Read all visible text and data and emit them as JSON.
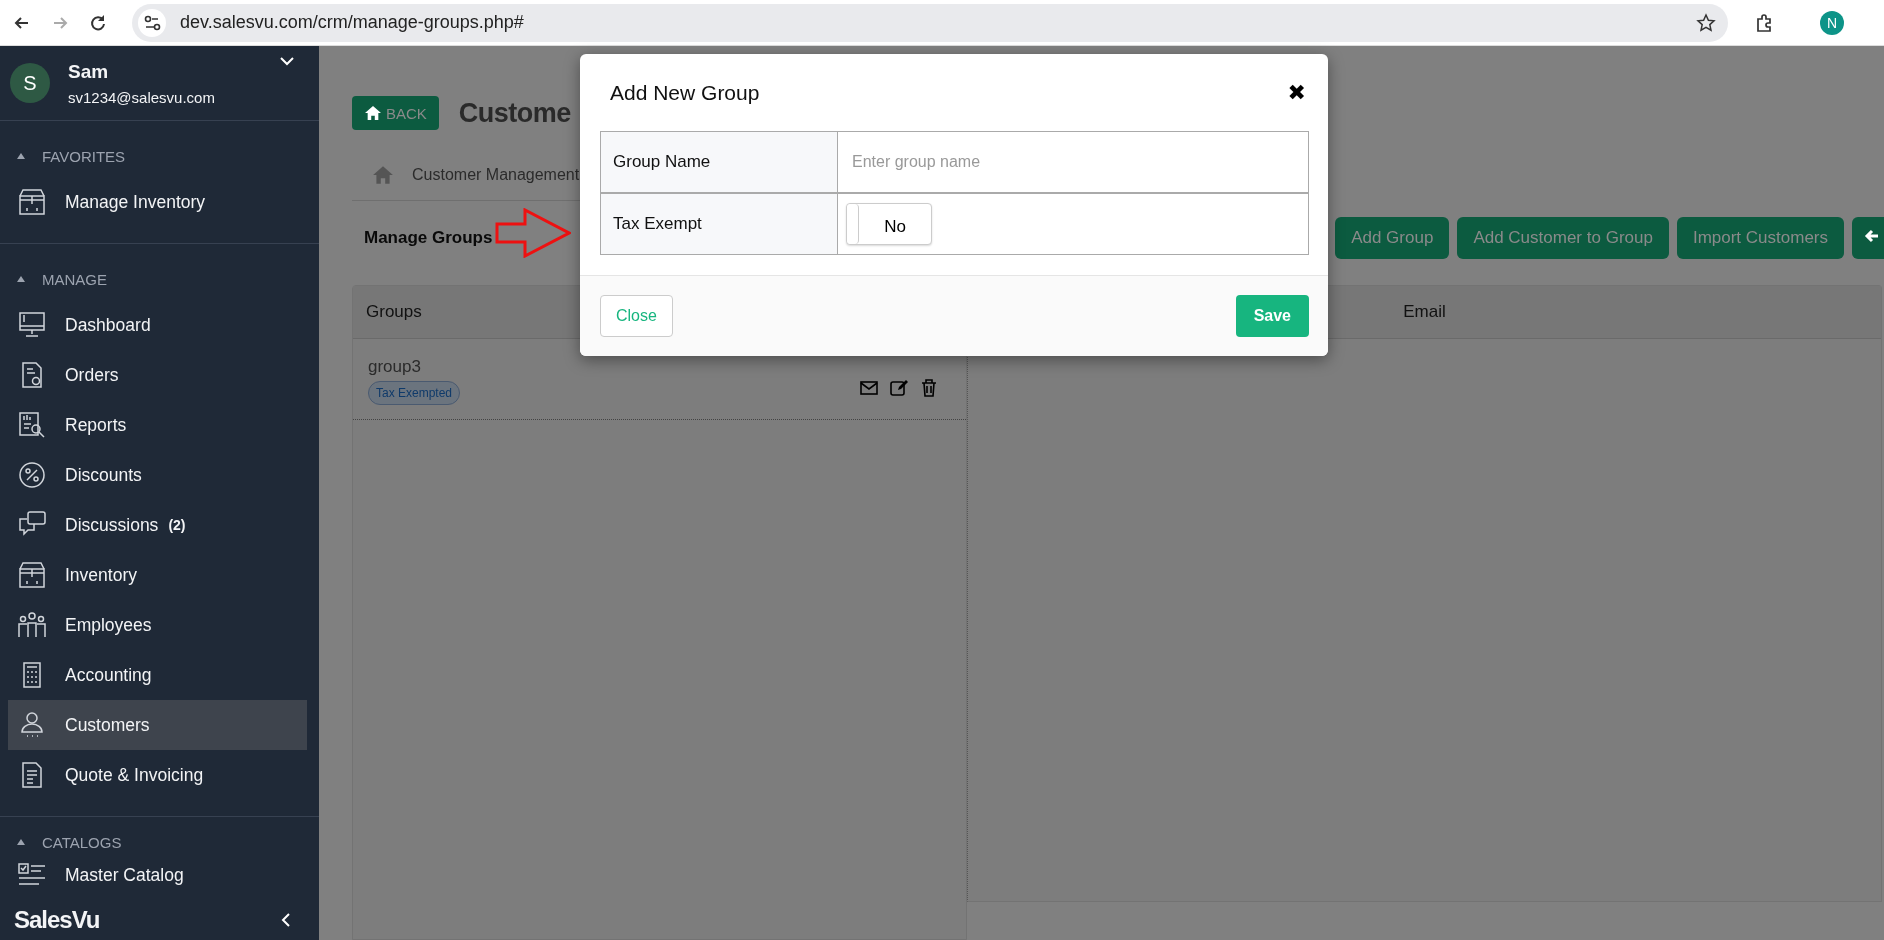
{
  "browser": {
    "url": "dev.salesvu.com/crm/manage-groups.php#",
    "profile": "N"
  },
  "sidebar": {
    "user": {
      "initial": "S",
      "name": "Sam",
      "email": "sv1234@salesvu.com"
    },
    "sections": [
      {
        "title": "FAVORITES",
        "expanded": true,
        "items": [
          {
            "label": "Manage Inventory",
            "selected": false
          }
        ]
      },
      {
        "title": "MANAGE",
        "expanded": true,
        "items": [
          {
            "label": "Dashboard",
            "selected": false
          },
          {
            "label": "Orders",
            "selected": false
          },
          {
            "label": "Reports",
            "selected": false
          },
          {
            "label": "Discounts",
            "selected": false
          },
          {
            "label": "Discussions",
            "count": "(2)",
            "selected": false
          },
          {
            "label": "Inventory",
            "selected": false
          },
          {
            "label": "Employees",
            "selected": false
          },
          {
            "label": "Accounting",
            "selected": false
          },
          {
            "label": "Customers",
            "selected": true
          },
          {
            "label": "Quote & Invoicing",
            "selected": false
          }
        ]
      },
      {
        "title": "CATALOGS",
        "expanded": true,
        "items": [
          {
            "label": "Master Catalog",
            "selected": false
          }
        ]
      }
    ],
    "logo": "SalesVu"
  },
  "page": {
    "back": "BACK",
    "title": "Custome",
    "breadcrumb": "Customer Management",
    "section_title": "Manage Groups",
    "buttons": [
      "Add Group",
      "Add Customer to Group",
      "Import Customers"
    ],
    "groups_header": "Groups",
    "groups": [
      {
        "name": "group3",
        "badge": "Tax Exempted"
      }
    ],
    "members_columns": [
      "Email"
    ]
  },
  "dialog": {
    "title": "Add New Group",
    "close": "✖",
    "fields": [
      {
        "kind": "text",
        "label": "Group Name",
        "placeholder": "Enter group name"
      },
      {
        "kind": "toggle",
        "label": "Tax Exempt",
        "on": false,
        "value": "No"
      }
    ],
    "buttons": [
      "Close",
      "Save"
    ]
  }
}
